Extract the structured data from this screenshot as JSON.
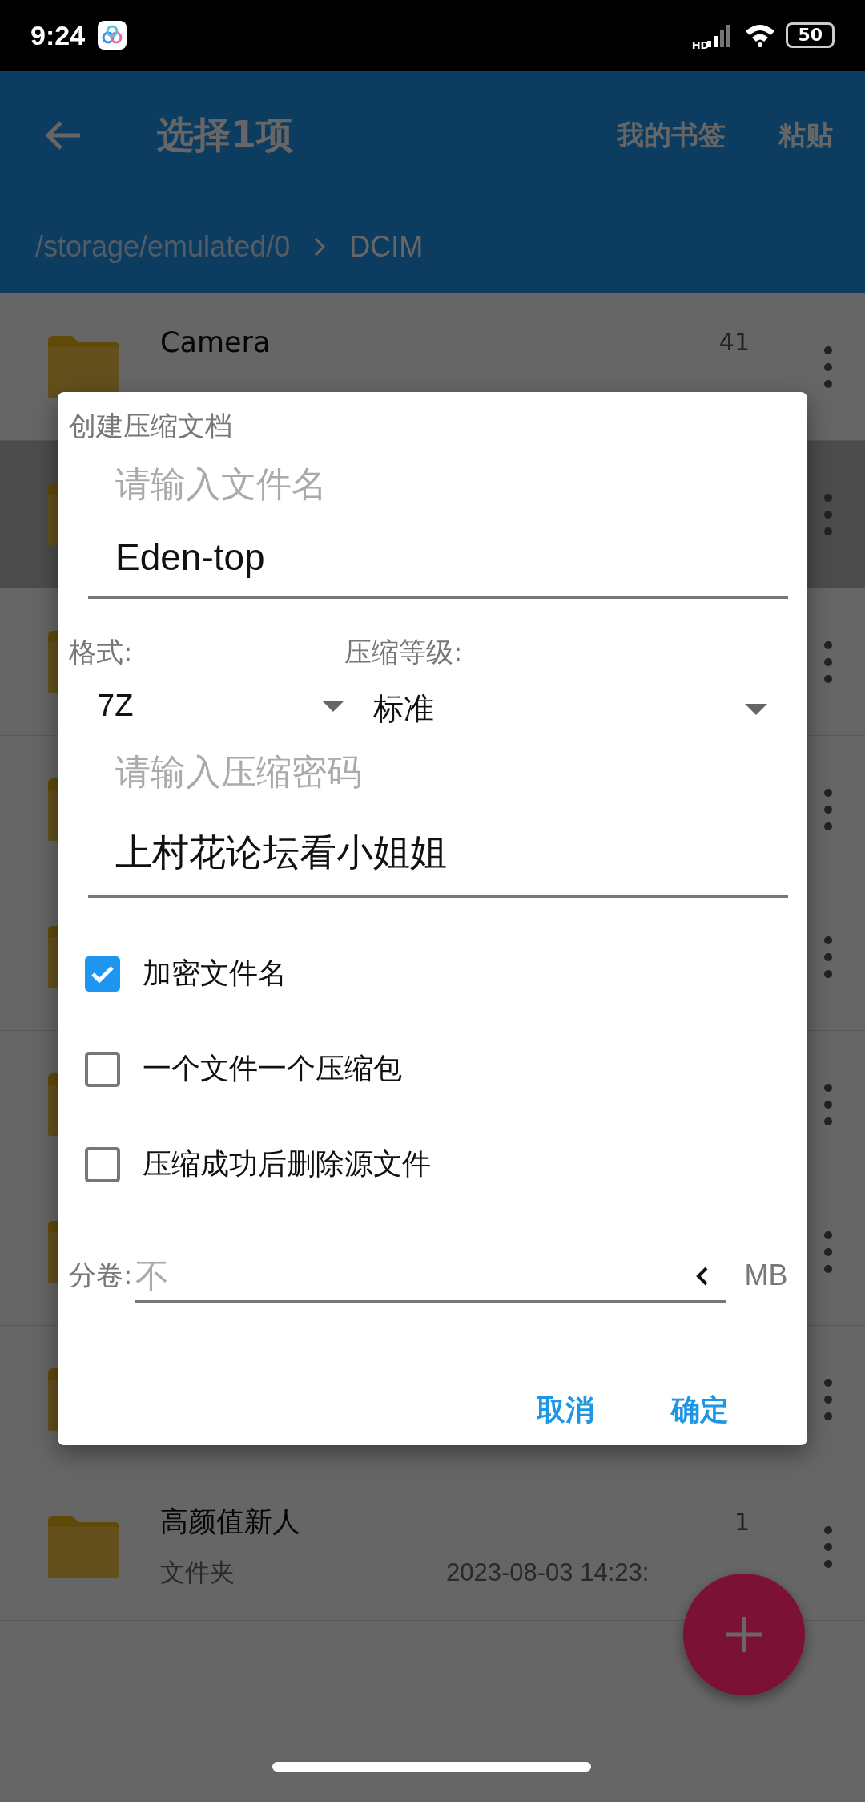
{
  "status_bar": {
    "time": "9:24",
    "network": "HD",
    "battery": "50"
  },
  "app_bar": {
    "title": "选择1项",
    "actions": [
      "我的书签",
      "粘贴"
    ]
  },
  "breadcrumb": [
    {
      "label": "/storage/emulated/0"
    },
    {
      "label": "DCIM"
    }
  ],
  "folders": [
    {
      "name": "Camera",
      "count": "41",
      "selected": false
    },
    {
      "selected": true
    },
    {
      "selected": false
    },
    {
      "selected": false
    },
    {
      "selected": false
    },
    {
      "selected": false
    },
    {
      "selected": false
    },
    {
      "selected": false
    },
    {
      "name": "高颜值新人",
      "count": "1",
      "type": "文件夹",
      "date": "2023-08-03 14:23:",
      "selected": false
    }
  ],
  "dialog": {
    "title": "创建压缩文档",
    "filename": {
      "label": "请输入文件名",
      "value": "Eden-top"
    },
    "format": {
      "label": "格式:",
      "value": "7Z"
    },
    "level": {
      "label": "压缩等级:",
      "value": "标准"
    },
    "password": {
      "label": "请输入压缩密码",
      "value": "上村花论坛看小姐姐"
    },
    "options": [
      {
        "label": "加密文件名",
        "checked": true
      },
      {
        "label": "一个文件一个压缩包",
        "checked": false
      },
      {
        "label": "压缩成功后删除源文件",
        "checked": false
      }
    ],
    "split": {
      "label": "分卷:",
      "placeholder": "不",
      "unit": "MB"
    },
    "buttons": [
      "取消",
      "确定"
    ]
  }
}
